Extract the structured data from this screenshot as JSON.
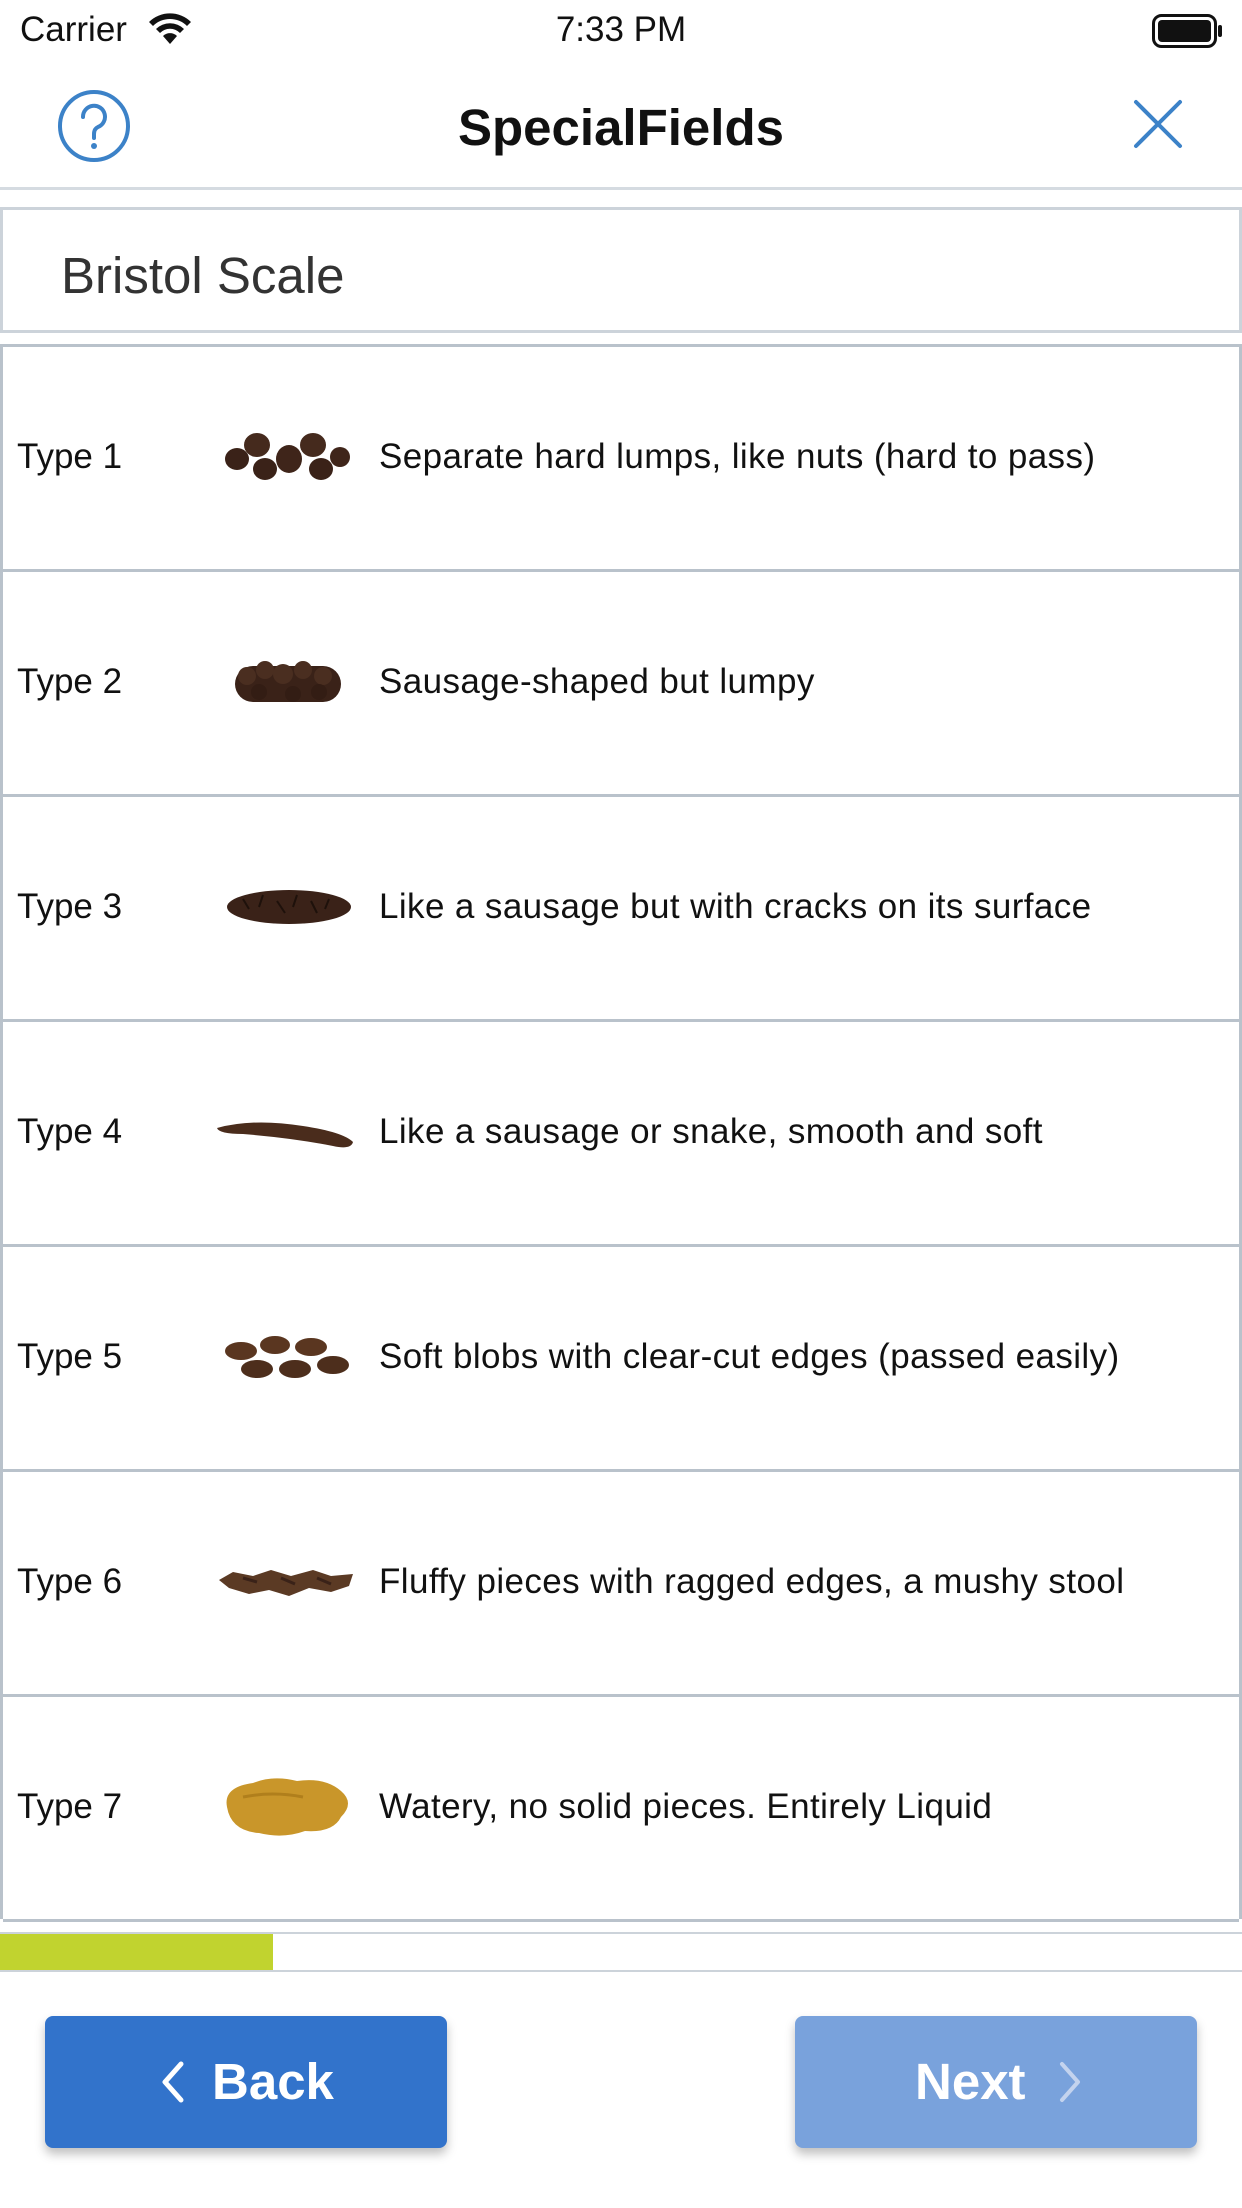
{
  "status_bar": {
    "carrier": "Carrier",
    "time": "7:33 PM"
  },
  "nav": {
    "title": "SpecialFields"
  },
  "section": {
    "title": "Bristol Scale"
  },
  "types": [
    {
      "label": "Type 1",
      "description": "Separate hard lumps, like nuts (hard to pass)",
      "icon": "type-1-stool-icon"
    },
    {
      "label": "Type 2",
      "description": "Sausage-shaped but lumpy",
      "icon": "type-2-stool-icon"
    },
    {
      "label": "Type 3",
      "description": "Like a sausage but with cracks on its surface",
      "icon": "type-3-stool-icon"
    },
    {
      "label": "Type 4",
      "description": "Like a sausage or snake, smooth and soft",
      "icon": "type-4-stool-icon"
    },
    {
      "label": "Type 5",
      "description": "Soft blobs with clear-cut edges (passed easily)",
      "icon": "type-5-stool-icon"
    },
    {
      "label": "Type 6",
      "description": "Fluffy pieces with ragged edges, a mushy stool",
      "icon": "type-6-stool-icon"
    },
    {
      "label": "Type 7",
      "description": "Watery, no solid pieces. Entirely Liquid",
      "icon": "type-7-stool-icon"
    }
  ],
  "progress": {
    "fraction": 0.22
  },
  "buttons": {
    "back": "Back",
    "next": "Next"
  },
  "colors": {
    "accent": "#3273cb",
    "next_disabled": "#79a2dc",
    "progress": "#c1d32f",
    "brown": "#3a2218",
    "liquid": "#c9962a"
  }
}
